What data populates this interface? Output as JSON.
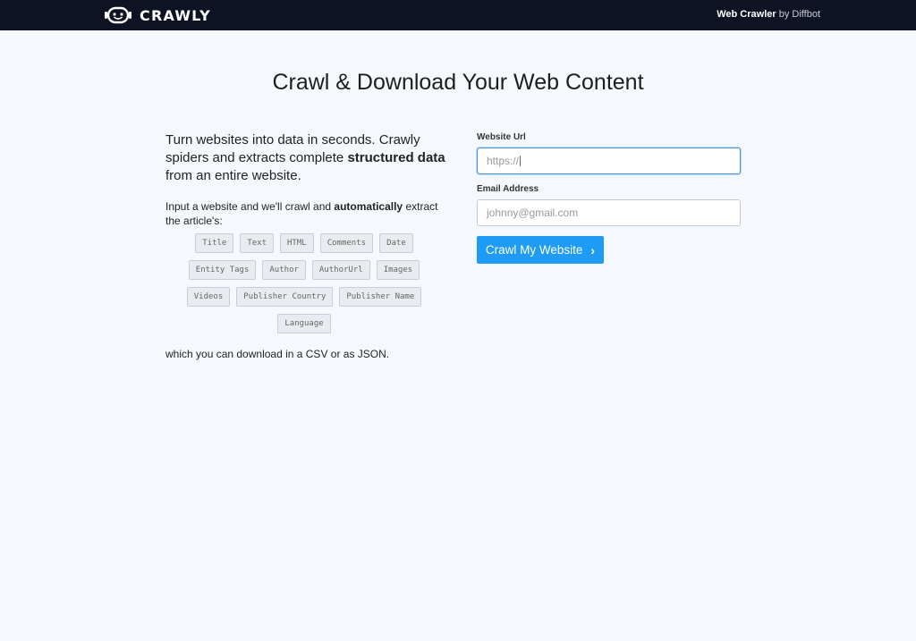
{
  "header": {
    "logo_text": "CRAWLY",
    "logo_icon": "robot-face-icon",
    "brand_link_strong": "Web Crawler",
    "brand_link_rest": " by Diffbot"
  },
  "page_title": "Crawl & Download Your Web Content",
  "intro": {
    "lead_part1": "Turn websites into data in seconds. Crawly spiders and extracts complete ",
    "lead_bold": "structured data",
    "lead_part2": " from an entire website.",
    "sub_part1": "Input a website and we'll crawl and ",
    "sub_bold": "automatically",
    "sub_part2": " extract the article's:",
    "tags": [
      "Title",
      "Text",
      "HTML",
      "Comments",
      "Date",
      "Entity Tags",
      "Author",
      "AuthorUrl",
      "Images",
      "Videos",
      "Publisher Country",
      "Publisher Name",
      "Language"
    ],
    "after_text": "which you can download in a CSV or as JSON."
  },
  "form": {
    "url_label": "Website Url",
    "url_placeholder": "https://",
    "email_label": "Email Address",
    "email_placeholder": "johnny@gmail.com",
    "submit_label": "Crawl My Website",
    "submit_icon": "chevron-right-icon"
  },
  "colors": {
    "topbar": "#0d1322",
    "background": "#f5f9fe",
    "accent": "#1e9cf5",
    "focus_border": "#3a91e0"
  }
}
